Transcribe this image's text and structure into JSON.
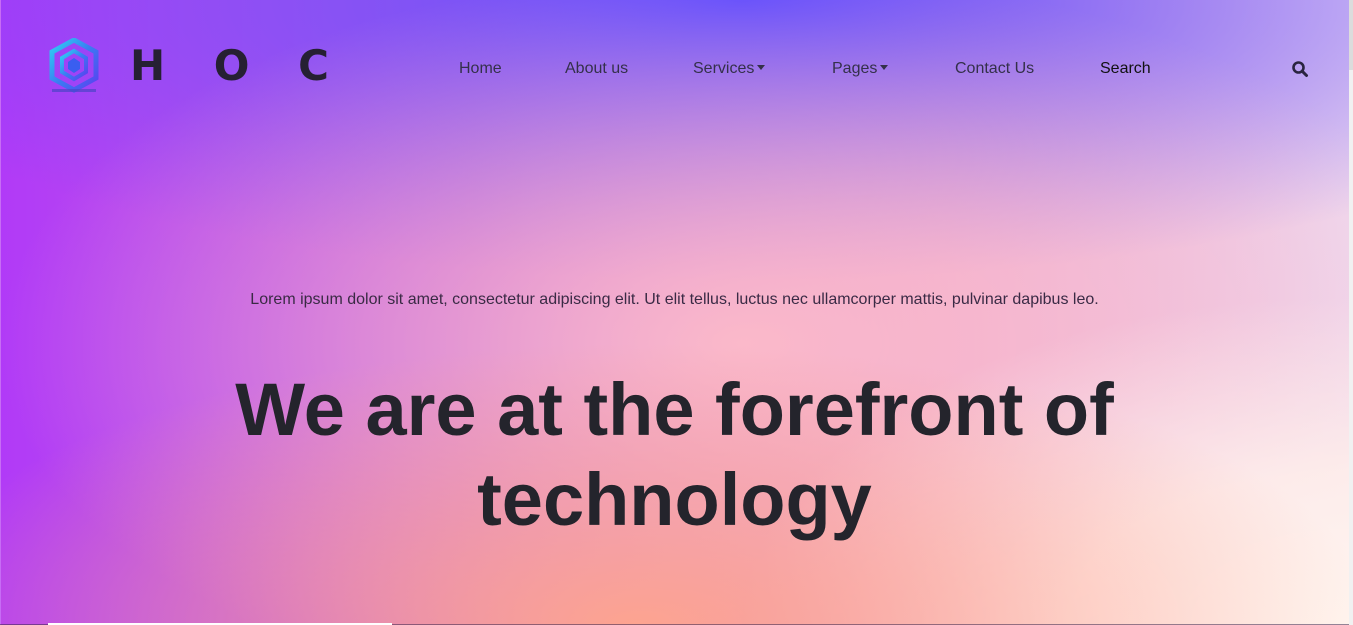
{
  "header": {
    "logo_text": "H O C",
    "nav": {
      "home": "Home",
      "about": "About us",
      "services": "Services",
      "pages": "Pages",
      "contact": "Contact Us",
      "search": "Search"
    },
    "icons": {
      "logo": "hexagon-cube-logo-icon",
      "search": "search-icon",
      "dropdown": "caret-down-icon"
    }
  },
  "hero": {
    "intro": "Lorem ipsum dolor sit amet, consectetur adipiscing elit. Ut elit tellus, luctus nec ullamcorper mattis, pulvinar dapibus leo.",
    "headline_line1": "We are at the forefront of",
    "headline_line2": "technology"
  },
  "colors": {
    "gradient_left": "#b13af7",
    "gradient_top": "#5f4bff",
    "gradient_peach": "#ffa58c",
    "gradient_light": "#fff6f0",
    "text_dark": "#24242c"
  }
}
